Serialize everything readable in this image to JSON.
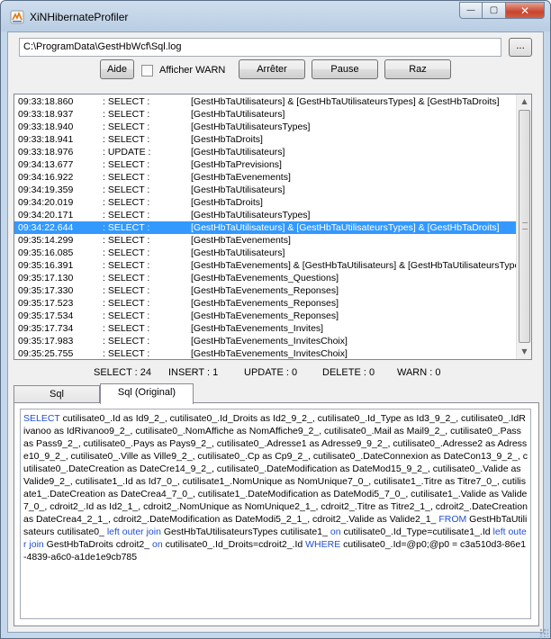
{
  "window": {
    "title": "XiNHibernateProfiler",
    "caption_minimize": "—",
    "caption_maximize": "▢",
    "caption_close": "✕"
  },
  "toolbar": {
    "path_value": "C:\\ProgramData\\GestHbWcf\\Sql.log",
    "browse_label": "...",
    "help_label": "Aide",
    "show_warn_label": "Afficher WARN",
    "show_warn_checked": false,
    "stop_label": "Arrêter",
    "pause_label": "Pause",
    "reset_label": "Raz"
  },
  "log": {
    "selected_index": 11,
    "rows": [
      {
        "time": "09:33:18.860",
        "type": ": SELECT :",
        "tables": "[GestHbTaUtilisateurs] & [GestHbTaUtilisateursTypes] & [GestHbTaDroits]"
      },
      {
        "time": "09:33:18.937",
        "type": ": SELECT :",
        "tables": "[GestHbTaUtilisateurs]"
      },
      {
        "time": "09:33:18.940",
        "type": ": SELECT :",
        "tables": "[GestHbTaUtilisateursTypes]"
      },
      {
        "time": "09:33:18.941",
        "type": ": SELECT :",
        "tables": "[GestHbTaDroits]"
      },
      {
        "time": "09:33:18.976",
        "type": ": UPDATE :",
        "tables": "[GestHbTaUtilisateurs]"
      },
      {
        "time": "09:34:13.677",
        "type": ": SELECT :",
        "tables": "[GestHbTaPrevisions]"
      },
      {
        "time": "09:34:16.922",
        "type": ": SELECT :",
        "tables": "[GestHbTaEvenements]"
      },
      {
        "time": "09:34:19.359",
        "type": ": SELECT :",
        "tables": "[GestHbTaUtilisateurs]"
      },
      {
        "time": "09:34:20.019",
        "type": ": SELECT :",
        "tables": "[GestHbTaDroits]"
      },
      {
        "time": "09:34:20.171",
        "type": ": SELECT :",
        "tables": "[GestHbTaUtilisateursTypes]"
      },
      {
        "time": "09:34:22.644",
        "type": ": SELECT :",
        "tables": "[GestHbTaUtilisateurs] & [GestHbTaUtilisateursTypes] & [GestHbTaDroits]"
      },
      {
        "time": "09:35:14.299",
        "type": ": SELECT :",
        "tables": "[GestHbTaEvenements]"
      },
      {
        "time": "09:35:16.085",
        "type": ": SELECT :",
        "tables": "[GestHbTaUtilisateurs]"
      },
      {
        "time": "09:35:16.391",
        "type": ": SELECT :",
        "tables": "[GestHbTaEvenements] & [GestHbTaUtilisateurs] & [GestHbTaUtilisateursTypes"
      },
      {
        "time": "09:35:17.130",
        "type": ": SELECT :",
        "tables": "[GestHbTaEvenements_Questions]"
      },
      {
        "time": "09:35:17.330",
        "type": ": SELECT :",
        "tables": "[GestHbTaEvenements_Reponses]"
      },
      {
        "time": "09:35:17.523",
        "type": ": SELECT :",
        "tables": "[GestHbTaEvenements_Reponses]"
      },
      {
        "time": "09:35:17.534",
        "type": ": SELECT :",
        "tables": "[GestHbTaEvenements_Reponses]"
      },
      {
        "time": "09:35:17.734",
        "type": ": SELECT :",
        "tables": "[GestHbTaEvenements_Invites]"
      },
      {
        "time": "09:35:17.983",
        "type": ": SELECT :",
        "tables": "[GestHbTaEvenements_InvitesChoix]"
      },
      {
        "time": "09:35:25.755",
        "type": ": SELECT :",
        "tables": "[GestHbTaEvenements_InvitesChoix]"
      }
    ]
  },
  "stats": {
    "select": "SELECT :  24",
    "insert": "INSERT :   1",
    "update": "UPDATE :   0",
    "delete": "DELETE :   0",
    "warn": "WARN :  0"
  },
  "tabs": [
    {
      "label": "Sql",
      "active": false
    },
    {
      "label": "Sql (Original)",
      "active": true
    }
  ],
  "sql_segments": [
    {
      "text": "SELECT",
      "kw": true
    },
    {
      "text": " cutilisate0_.Id as Id9_2_, cutilisate0_.Id_Droits as Id2_9_2_, cutilisate0_.Id_Type as Id3_9_2_, cutilisate0_.IdRivanoo as IdRivanoo9_2_, cutilisate0_.NomAffiche as NomAffiche9_2_, cutilisate0_.Mail as Mail9_2_, cutilisate0_.Pass as Pass9_2_, cutilisate0_.Pays as Pays9_2_, cutilisate0_.Adresse1 as Adresse9_9_2_, cutilisate0_.Adresse2 as Adresse10_9_2_, cutilisate0_.Ville as Ville9_2_, cutilisate0_.Cp as Cp9_2_, cutilisate0_.DateConnexion as DateCon13_9_2_, cutilisate0_.DateCreation as DateCre14_9_2_, cutilisate0_.DateModification as DateMod15_9_2_, cutilisate0_.Valide as Valide9_2_, cutilisate1_.Id as Id7_0_, cutilisate1_.NomUnique as NomUnique7_0_, cutilisate1_.Titre as Titre7_0_, cutilisate1_.DateCreation as DateCrea4_7_0_, cutilisate1_.DateModification as DateModi5_7_0_, cutilisate1_.Valide as Valide7_0_, cdroit2_.Id as Id2_1_, cdroit2_.NomUnique as NomUnique2_1_, cdroit2_.Titre as Titre2_1_, cdroit2_.DateCreation as DateCrea4_2_1_, cdroit2_.DateModification as DateModi5_2_1_, cdroit2_.Valide as Valide2_1_ ",
      "kw": false
    },
    {
      "text": "FROM",
      "kw": true
    },
    {
      "text": " GestHbTaUtilisateurs cutilisate0_ ",
      "kw": false
    },
    {
      "text": "left outer join",
      "kw": true
    },
    {
      "text": " GestHbTaUtilisateursTypes cutilisate1_ ",
      "kw": false
    },
    {
      "text": "on",
      "kw": true
    },
    {
      "text": " cutilisate0_.Id_Type=cutilisate1_.Id ",
      "kw": false
    },
    {
      "text": "left outer join",
      "kw": true
    },
    {
      "text": " GestHbTaDroits cdroit2_ ",
      "kw": false
    },
    {
      "text": "on",
      "kw": true
    },
    {
      "text": " cutilisate0_.Id_Droits=cdroit2_.Id ",
      "kw": false
    },
    {
      "text": "WHERE",
      "kw": true
    },
    {
      "text": " cutilisate0_.Id=@p0;@p0 = c3a510d3-86e1-4839-a6c0-a1de1e9cb785",
      "kw": false
    }
  ],
  "colors": {
    "selection": "#3399ff",
    "sql_keyword": "#1f4fd1"
  }
}
